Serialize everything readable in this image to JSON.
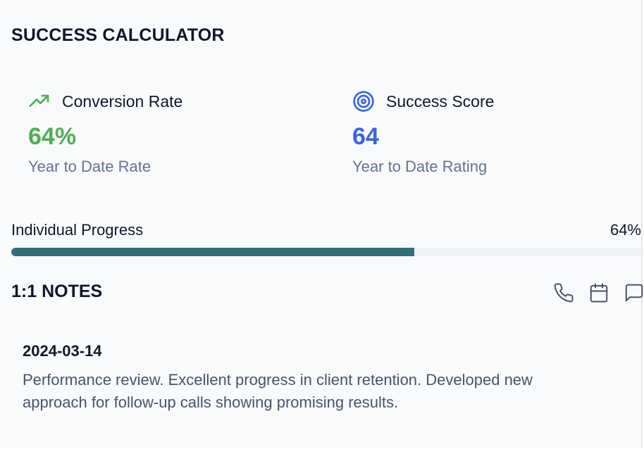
{
  "section_title": "SUCCESS CALCULATOR",
  "metrics": [
    {
      "icon": "trending-up-icon",
      "label": "Conversion Rate",
      "value": "64%",
      "sub": "Year to Date Rate",
      "color": "#4caf50"
    },
    {
      "icon": "target-icon",
      "label": "Success Score",
      "value": "64",
      "sub": "Year to Date Rating",
      "color": "#3b63e0"
    }
  ],
  "progress": {
    "label": "Individual Progress",
    "percent_label": "64%",
    "value": 0.64,
    "fill_color": "#2f6e7a"
  },
  "notes": {
    "title": "1:1 NOTES",
    "actions": [
      "phone-icon",
      "calendar-icon",
      "message-icon"
    ],
    "items": [
      {
        "date": "2024-03-14",
        "text": "Performance review. Excellent progress in client retention. Developed new approach for follow-up calls showing promising results."
      }
    ]
  }
}
